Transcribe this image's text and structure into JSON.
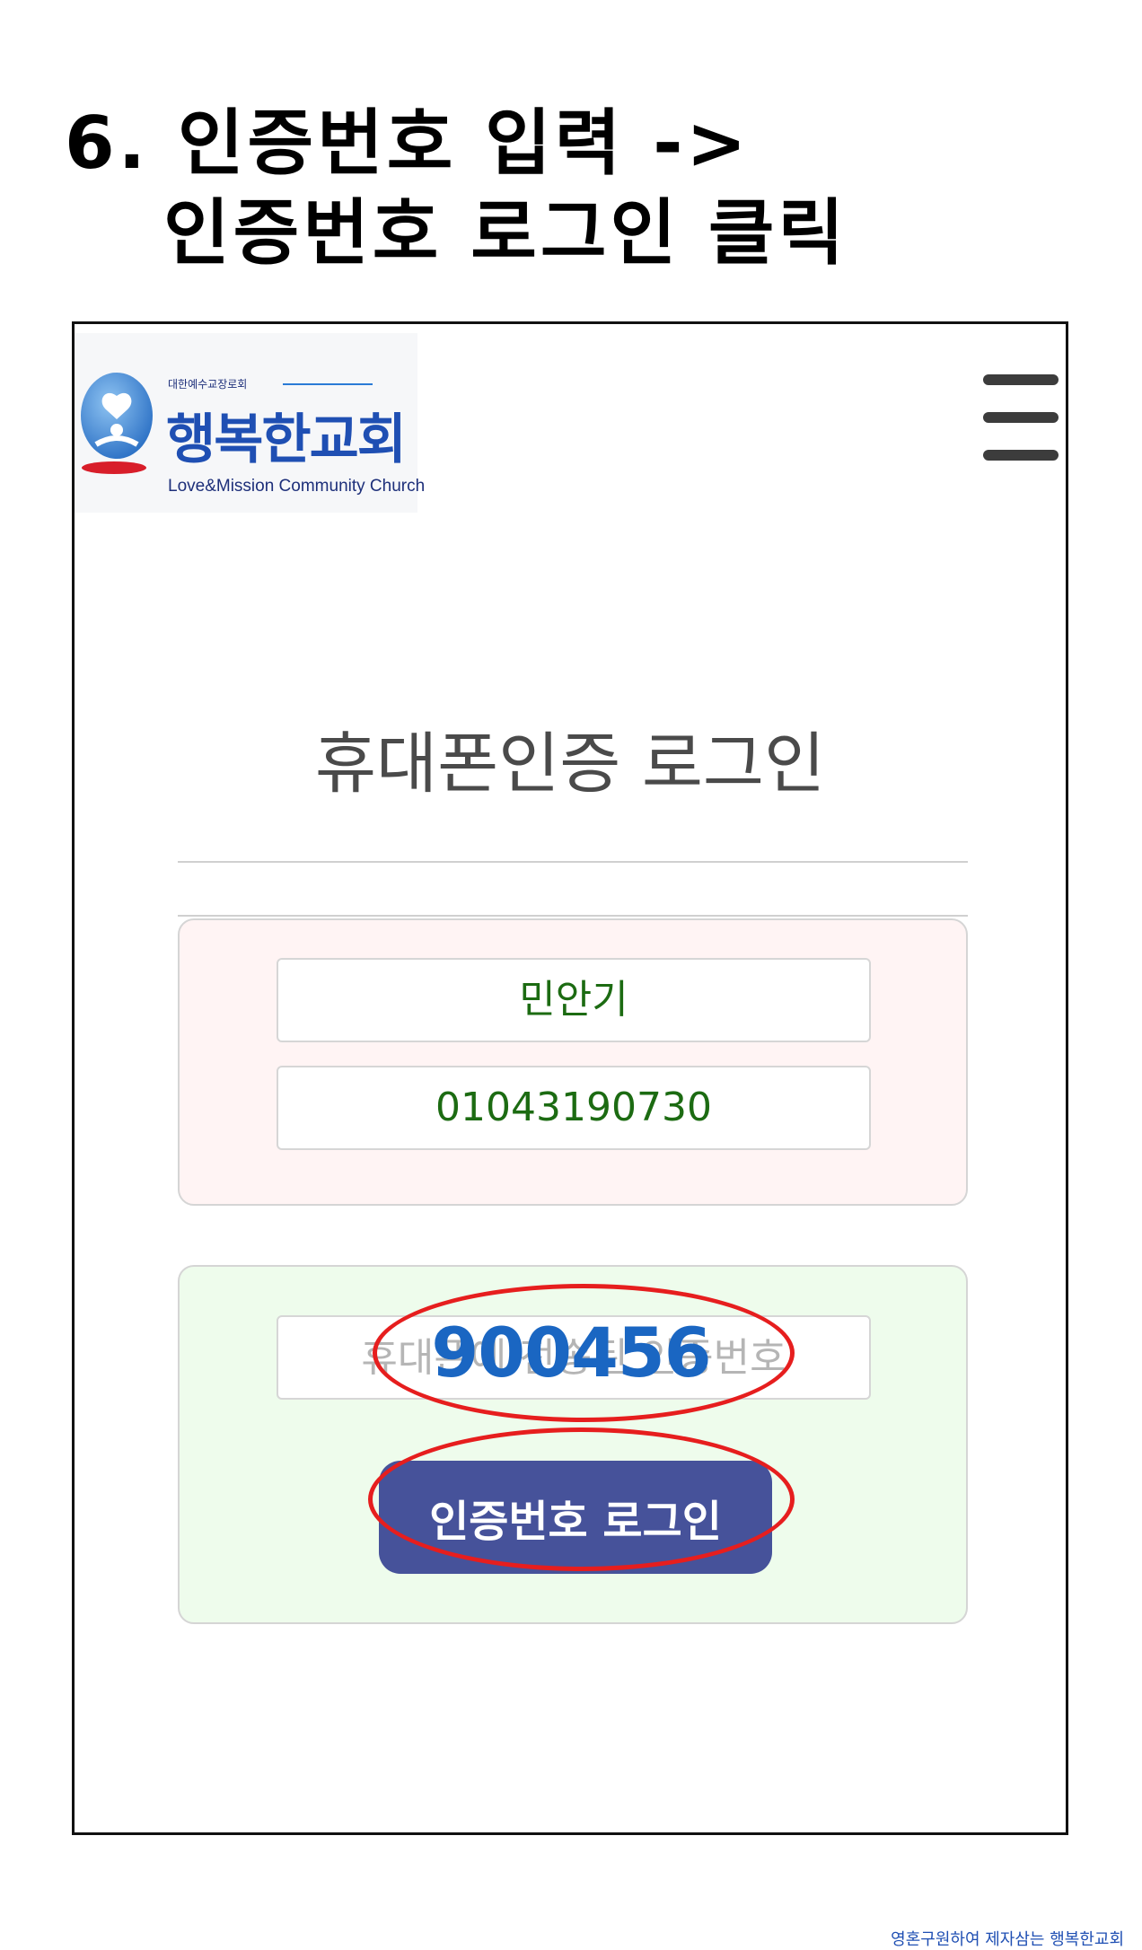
{
  "slide": {
    "title_line1": "6. 인증번호 입력 ->",
    "title_line2": "인증번호 로그인 클릭"
  },
  "logo": {
    "icon": "church-logo-icon",
    "subtitle": "대한예수교장로회",
    "name": "행복한교회",
    "english": "Love&Mission Community Church"
  },
  "header": {
    "menu_icon": "hamburger-menu-icon"
  },
  "page": {
    "heading": "휴대폰인증 로그인"
  },
  "user_info": {
    "name": "민안기",
    "phone": "01043190730"
  },
  "verify": {
    "placeholder": "휴대폰에 전송된 인증번호",
    "typed_code": "900456",
    "button_label": "인증번호 로그인"
  },
  "annotation": {
    "color": "#e61e1e"
  },
  "colors": {
    "button": "#46529a",
    "field_text": "#1c6b12",
    "code_text": "#1a66c2",
    "info_panel": "#fff4f4",
    "verify_panel": "#eefcec"
  },
  "footer": {
    "watermark": "영혼구원하여 제자삼는 행복한교회"
  }
}
